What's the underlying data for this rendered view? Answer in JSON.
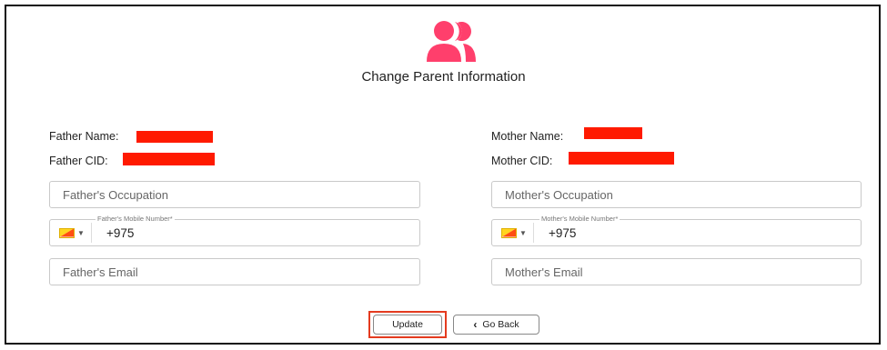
{
  "page": {
    "title": "Change Parent Information",
    "icon": "users-icon",
    "accent_color": "#ff3f6c",
    "redaction_color": "#ff1a00"
  },
  "father": {
    "name_label": "Father Name:",
    "cid_label": "Father CID:",
    "occupation_placeholder": "Father's Occupation",
    "mobile_legend": "Father's Mobile Number*",
    "mobile_value": "+975",
    "email_placeholder": "Father's Email"
  },
  "mother": {
    "name_label": "Mother Name:",
    "cid_label": "Mother CID:",
    "occupation_placeholder": "Mother's Occupation",
    "mobile_legend": "Mother's Mobile Number*",
    "mobile_value": "+975",
    "email_placeholder": "Mother's Email"
  },
  "actions": {
    "update_label": "Update",
    "back_label": "Go Back",
    "back_icon": "chevron-left-icon"
  }
}
